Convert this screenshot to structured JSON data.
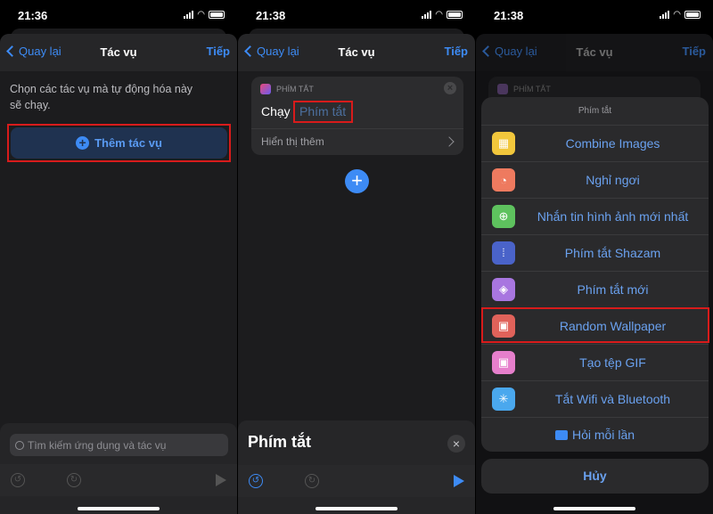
{
  "panels": [
    {
      "time": "21:36",
      "nav": {
        "back": "Quay lại",
        "title": "Tác vụ",
        "next": "Tiếp"
      },
      "description": "Chọn các tác vụ mà tự động hóa này sẽ chạy.",
      "add_action": "Thêm tác vụ",
      "search": {
        "placeholder": "Tìm kiếm ứng dụng và tác vụ"
      }
    },
    {
      "time": "21:38",
      "nav": {
        "back": "Quay lại",
        "title": "Tác vụ",
        "next": "Tiếp"
      },
      "card": {
        "app": "PHÍM TẮT",
        "verb": "Chạy",
        "param": "Phím tắt",
        "more": "Hiển thị thêm"
      },
      "sheet_title": "Phím tắt"
    },
    {
      "time": "21:38",
      "nav": {
        "back": "Quay lại",
        "title": "Tác vụ",
        "next": "Tiếp"
      },
      "card_app": "PHÍM TẮT",
      "action_sheet": {
        "title": "Phím tắt",
        "items": [
          {
            "label": "Combine Images",
            "icon": "grid-icon",
            "color": "#f2c73c"
          },
          {
            "label": "Nghỉ ngơi",
            "icon": "timer-icon",
            "color": "#ee7a5f"
          },
          {
            "label": "Nhắn tin hình ảnh mới nhất",
            "icon": "message-plus-icon",
            "color": "#5ec25e"
          },
          {
            "label": "Phím tắt Shazam",
            "icon": "waveform-icon",
            "color": "#4a63c9"
          },
          {
            "label": "Phím tắt mới",
            "icon": "layers-icon",
            "color": "#a876e0"
          },
          {
            "label": "Random Wallpaper",
            "icon": "photos-icon",
            "color": "#e0625a"
          },
          {
            "label": "Tạo tệp GIF",
            "icon": "photos-icon",
            "color": "#e67fcc"
          },
          {
            "label": "Tắt Wifi và Bluetooth",
            "icon": "sparkle-icon",
            "color": "#4aa8ee"
          }
        ],
        "ask": "Hỏi mỗi lần",
        "cancel": "Hủy"
      }
    }
  ],
  "colors": {
    "accent": "#3d8bf5",
    "highlight": "#d81b1b"
  }
}
